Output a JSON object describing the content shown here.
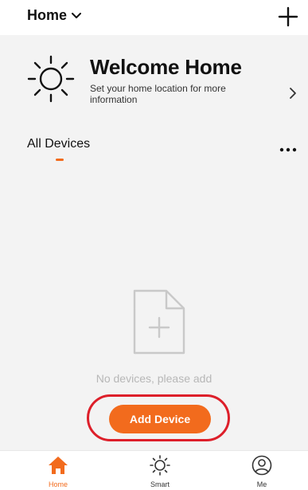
{
  "header": {
    "home_label": "Home"
  },
  "welcome": {
    "title": "Welcome Home",
    "subtitle": "Set your home location for more information"
  },
  "devices": {
    "section_title": "All Devices",
    "empty_message": "No devices, please add",
    "add_button_label": "Add Device"
  },
  "tabs": [
    {
      "label": "Home",
      "icon": "home-icon",
      "active": true
    },
    {
      "label": "Smart",
      "icon": "sun-icon",
      "active": false
    },
    {
      "label": "Me",
      "icon": "user-icon",
      "active": false
    }
  ],
  "colors": {
    "accent": "#f26b1d",
    "highlight": "#dd1f2a",
    "empty_text": "#b7b7b7"
  }
}
